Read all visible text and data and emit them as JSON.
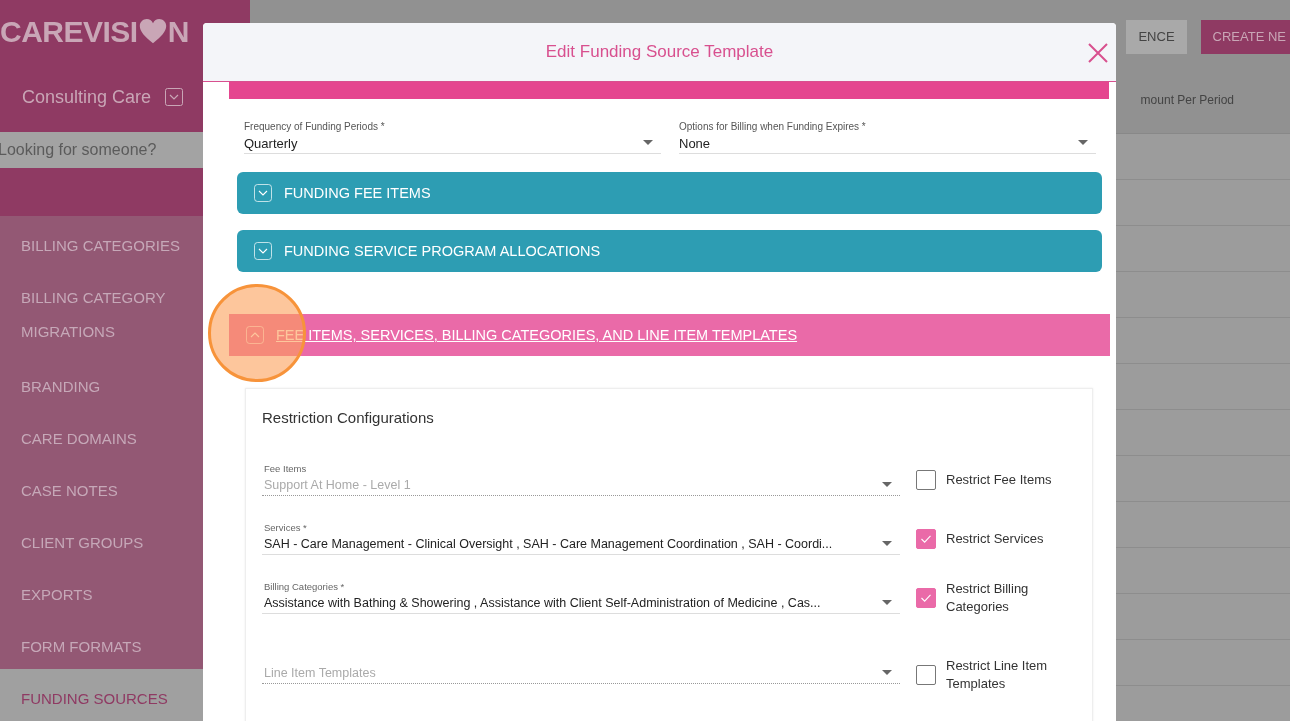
{
  "sidebar": {
    "logo": {
      "start": "CAREVISI",
      "end": "N"
    },
    "organization": "Consulting Care",
    "search": {
      "placeholder": "Looking for someone?"
    },
    "items": [
      {
        "label": "BILLING CATEGORIES",
        "selected": false
      },
      {
        "label": "BILLING CATEGORY MIGRATIONS",
        "selected": false
      },
      {
        "label": "BRANDING",
        "selected": false
      },
      {
        "label": "CARE DOMAINS",
        "selected": false
      },
      {
        "label": "CASE NOTES",
        "selected": false
      },
      {
        "label": "CLIENT GROUPS",
        "selected": false
      },
      {
        "label": "EXPORTS",
        "selected": false
      },
      {
        "label": "FORM FORMATS",
        "selected": false
      },
      {
        "label": "FUNDING SOURCES",
        "selected": true
      }
    ]
  },
  "page": {
    "buttons": [
      {
        "label": "ENCE",
        "kind": "secondary"
      },
      {
        "label": "CREATE NE",
        "kind": "primary"
      }
    ],
    "column_header": "mount Per Period"
  },
  "dialog": {
    "title": "Edit Funding Source Template",
    "fields": [
      {
        "label": "Frequency of Funding Periods *",
        "value": "Quarterly"
      },
      {
        "label": "Options for Billing when Funding Expires *",
        "value": "None"
      }
    ],
    "sections": [
      {
        "kind": "teal",
        "label": "FUNDING FEE ITEMS",
        "expanded": false
      },
      {
        "kind": "teal",
        "label": "FUNDING SERVICE PROGRAM ALLOCATIONS",
        "expanded": false
      },
      {
        "kind": "pink",
        "label": "FEE ITEMS, SERVICES, BILLING CATEGORIES, AND LINE ITEM TEMPLATES",
        "expanded": true
      }
    ],
    "restrictions": {
      "title": "Restriction Configurations",
      "rows": [
        {
          "label": "Fee Items",
          "value": "Support At Home - Level 1",
          "disabled": true,
          "option": "Restrict Fee Items",
          "checked": false
        },
        {
          "label": "Services *",
          "value": "SAH - Care Management - Clinical Oversight , SAH - Care Management Coordination , SAH - Coordi...",
          "disabled": false,
          "option": "Restrict Services",
          "checked": true
        },
        {
          "label": "Billing Categories *",
          "value": "Assistance with Bathing & Showering , Assistance with Client Self-Administration of Medicine , Cas...",
          "disabled": false,
          "option": "Restrict Billing Categories",
          "checked": true
        },
        {
          "placeholder": "Line Item Templates",
          "disabled": true,
          "option": "Restrict Line Item Templates",
          "checked": false
        }
      ]
    }
  }
}
